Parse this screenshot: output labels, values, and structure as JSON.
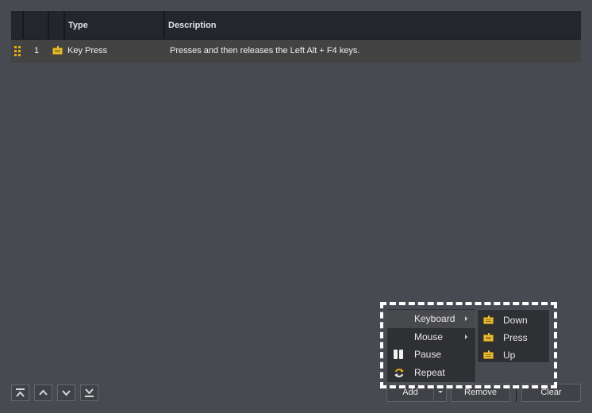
{
  "table": {
    "columns": [
      "",
      "",
      "",
      "Type",
      "Description"
    ],
    "rows": [
      {
        "grip_icon": "drag-grip-icon",
        "number": "1",
        "icon": "keyboard-icon",
        "type": "Key Press",
        "description": "Presses and then releases the Left Alt + F4 keys."
      }
    ]
  },
  "nav_buttons": [
    {
      "name": "move-to-top",
      "icon": "double-chevron-up-icon"
    },
    {
      "name": "move-up",
      "icon": "chevron-up-icon"
    },
    {
      "name": "move-down",
      "icon": "chevron-down-icon"
    },
    {
      "name": "move-to-bottom",
      "icon": "double-chevron-down-icon"
    }
  ],
  "actions": {
    "add": "Add",
    "remove": "Remove",
    "clear": "Clear"
  },
  "add_menu": {
    "items": [
      {
        "label": "Keyboard",
        "submenu": true,
        "active": true
      },
      {
        "label": "Mouse",
        "submenu": true
      },
      {
        "label": "Pause",
        "icon": "pause-icon"
      },
      {
        "label": "Repeat",
        "icon": "repeat-icon"
      }
    ],
    "keyboard_submenu": [
      {
        "label": "Down",
        "icon": "keyboard-icon"
      },
      {
        "label": "Press",
        "icon": "keyboard-icon"
      },
      {
        "label": "Up",
        "icon": "keyboard-icon"
      }
    ]
  },
  "colors": {
    "background": "#474a51",
    "header": "#25262b",
    "row": "#434343",
    "accent": "#e8b010",
    "highlight": "#ffffff"
  }
}
